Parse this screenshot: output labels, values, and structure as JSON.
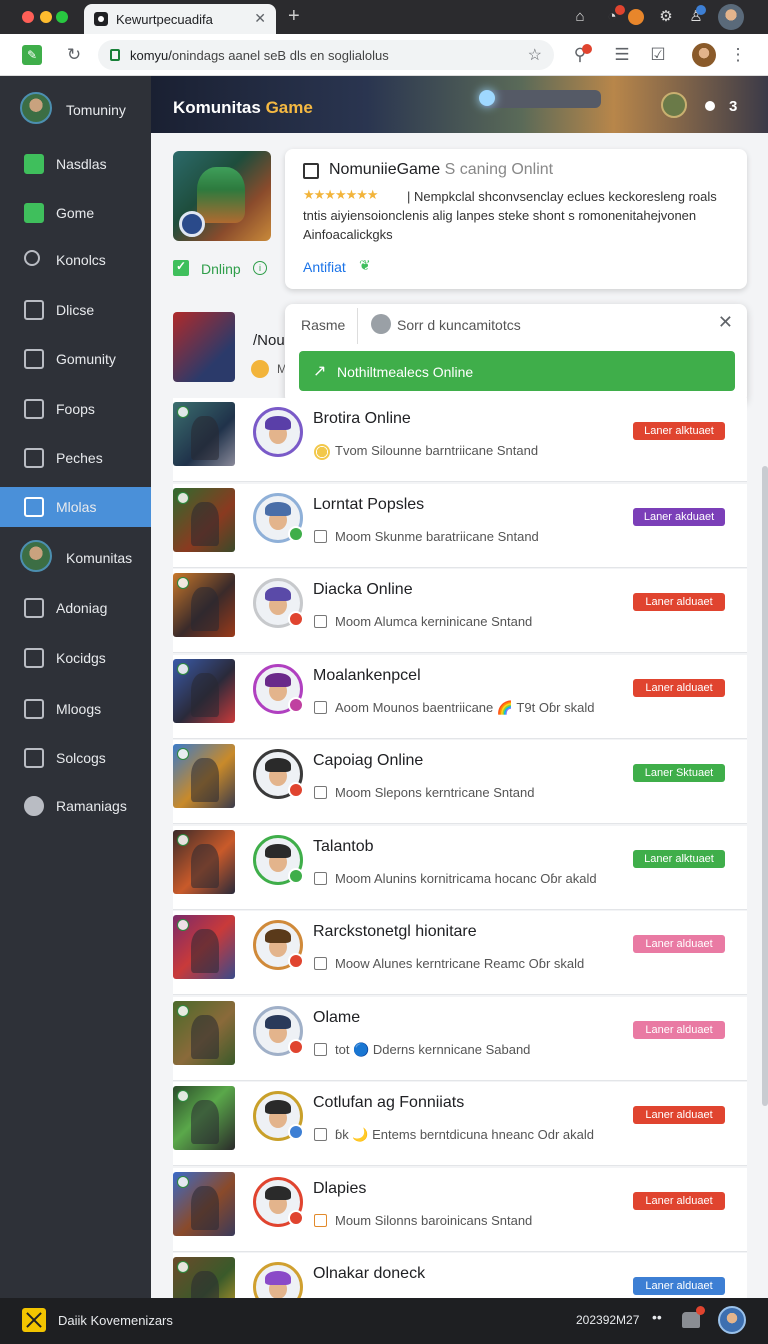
{
  "colors": {
    "sidebar_bg": "#2e3138",
    "sidebar_active": "#4a90d9",
    "accent_green": "#3fae4a",
    "badge_red": "#e0442f",
    "badge_purple": "#7b3fb8",
    "badge_green": "#3fae4a",
    "badge_pink": "#e97aa3",
    "badge_blue": "#3d7fd4"
  },
  "browser": {
    "tab_title": "Kewurtpecuadifa",
    "url_host": "komyu/",
    "url_path": "onindags aanel seB dls en soglialolus"
  },
  "sidebar": {
    "items": [
      {
        "label": "Tomuniny",
        "icon": "avatar-icon"
      },
      {
        "label": "Nasdlas",
        "icon": "grid-icon"
      },
      {
        "label": "Gome",
        "icon": "gamepad-icon"
      },
      {
        "label": "Konolcs",
        "icon": "search-icon"
      },
      {
        "label": "Dlicse",
        "icon": "square-icon"
      },
      {
        "label": "Gomunity",
        "icon": "chat-icon"
      },
      {
        "label": "Foops",
        "icon": "image-icon"
      },
      {
        "label": "Peches",
        "icon": "check-icon"
      },
      {
        "label": "Mlolas",
        "icon": "edit-icon"
      },
      {
        "label": "Komunitas",
        "icon": "avatar-icon"
      },
      {
        "label": "Adoniag",
        "icon": "dashboard-icon"
      },
      {
        "label": "Kocidgs",
        "icon": "link-icon"
      },
      {
        "label": "Mloogs",
        "icon": "mail-icon"
      },
      {
        "label": "Solcogs",
        "icon": "share-icon"
      },
      {
        "label": "Ramaniags",
        "icon": "circle-icon"
      }
    ]
  },
  "banner": {
    "title_white": "Komunitas",
    "title_accent": "Game",
    "count": "3"
  },
  "featured": {
    "status": "Dnlinp",
    "title": "NomuniieGame",
    "title_suffix": "S caning Onlint",
    "stars": "★★★★★★★",
    "description": "| Nempkclal shconvsenclay eclues keckoresleng roals tntis aiyiensoioncl​enis alig lanpes steke shont s romonenitahejvonen Ainfoacalickgks",
    "link": "Antifiat"
  },
  "search": {
    "label": "Rasme",
    "placeholder": "Sorr d kuncamitotcs",
    "button": "Nothiltmealecs Online"
  },
  "partial": {
    "name": "/Nou",
    "sub": "M"
  },
  "rows": [
    {
      "name": "Brotira Online",
      "sub": "Tvom Silounne barntriicane Sntand",
      "badge": "Laner alktuaet",
      "badge_color": "#e0442f",
      "thumb": "linear-gradient(135deg,#3b6f6f,#20324a 60%,#8a8a9a)",
      "hair": "#5a3fa8",
      "ring": "#7a5ac8",
      "status": null,
      "cb": "sun"
    },
    {
      "name": "Lorntat Popsles",
      "sub": "Moom Skunme baratriicane Sntand",
      "badge": "Laner akduaet",
      "badge_color": "#7b3fb8",
      "thumb": "linear-gradient(135deg,#2f6a2f,#8a3a20 60%,#3a4a2a)",
      "hair": "#4a6ea8",
      "ring": "#8fb0d8",
      "status": "#3fae4a",
      "cb": "box"
    },
    {
      "name": "Diacka Online",
      "sub": "Moom Alumca kerninicane Sntand",
      "badge": "Laner alduaet",
      "badge_color": "#e0442f",
      "thumb": "linear-gradient(135deg,#c9782a,#3a2a2a 55%,#9a3a1a)",
      "hair": "#5a4aa8",
      "ring": "#c7c9cc",
      "status": "#e0442f",
      "cb": "box"
    },
    {
      "name": "Moalankenpcel",
      "sub": "Aoom Mounos baentriicane 🌈 T9t Oɓr skald",
      "badge": "Laner alduaet",
      "badge_color": "#e0442f",
      "thumb": "linear-gradient(135deg,#3a5aa8,#2a2a3a 55%,#c93a3a)",
      "hair": "#6a2a8a",
      "ring": "#b040c0",
      "status": "#c040a0",
      "cb": "box"
    },
    {
      "name": "Capoiag Online",
      "sub": "Moom Slepons kerntricane Sntand",
      "badge": "Laner Sktuaet",
      "badge_color": "#3fae4a",
      "thumb": "linear-gradient(135deg,#3a7ac8,#c98a2a 55%,#3a3a4a)",
      "hair": "#2a2a2a",
      "ring": "#3a3a3a",
      "status": "#e0442f",
      "cb": "box"
    },
    {
      "name": "Talantob",
      "sub": "Moom Alunins kornitricama hocanc Oɓr akald",
      "badge": "Laner alktuaet",
      "badge_color": "#3fae4a",
      "thumb": "linear-gradient(135deg,#3a2a2a,#c95a2a 55%,#2a2a3a)",
      "hair": "#2a2a2a",
      "ring": "#3fae4a",
      "status": "#3fae4a",
      "cb": "box"
    },
    {
      "name": "Rarckstonetgl hionitare",
      "sub": "Moow Alunes kerntricane Reamc Oɓr skald",
      "badge": "Laner alduaet",
      "badge_color": "#e97aa3",
      "thumb": "linear-gradient(135deg,#7a2a6a,#c93a3a 50%,#3a4a8a)",
      "hair": "#5a3a1a",
      "ring": "#d08a3a",
      "status": "#e0442f",
      "cb": "box"
    },
    {
      "name": "Olame",
      "sub": "tot 🔵 Dderns kernnicane Saband",
      "badge": "Laner alduaet",
      "badge_color": "#e97aa3",
      "thumb": "linear-gradient(135deg,#4a6a2a,#8a6a3a 55%,#3a5a2a)",
      "hair": "#2a3a5a",
      "ring": "#a0b0c8",
      "status": "#e0442f",
      "cb": "box"
    },
    {
      "name": "Cotlufan ag Fonniiats",
      "sub": "ɓk 🌙 Entems berntdicuna hneanc Odr akald",
      "badge": "Laner alduaet",
      "badge_color": "#e0442f",
      "thumb": "linear-gradient(135deg,#2a4a2a,#5aa84a 45%,#2a2a2a)",
      "hair": "#2a2a2a",
      "ring": "#c9a02a",
      "status": "#3d7fd4",
      "cb": "box"
    },
    {
      "name": "Dlapies",
      "sub": "Moum Silonns baroinicans Sntand",
      "badge": "Laner alduaet",
      "badge_color": "#e0442f",
      "thumb": "linear-gradient(135deg,#3a6ac8,#8a4a2a 55%,#3a3a5a)",
      "hair": "#2a2a2a",
      "ring": "#e0442f",
      "status": "#e0442f",
      "cb": "orange"
    },
    {
      "name": "Olnakar doneck",
      "sub": "",
      "badge": "Laner alduaet",
      "badge_color": "#3d7fd4",
      "thumb": "linear-gradient(135deg,#6a4a2a,#3a5a2a 55%,#c9a02a)",
      "hair": "#8a4ac8",
      "ring": "#d0a030",
      "status": null,
      "cb": "none"
    }
  ],
  "taskbar": {
    "label": "Daiik Kovemenizars",
    "datetime": "202392M27",
    "dots": "••"
  }
}
